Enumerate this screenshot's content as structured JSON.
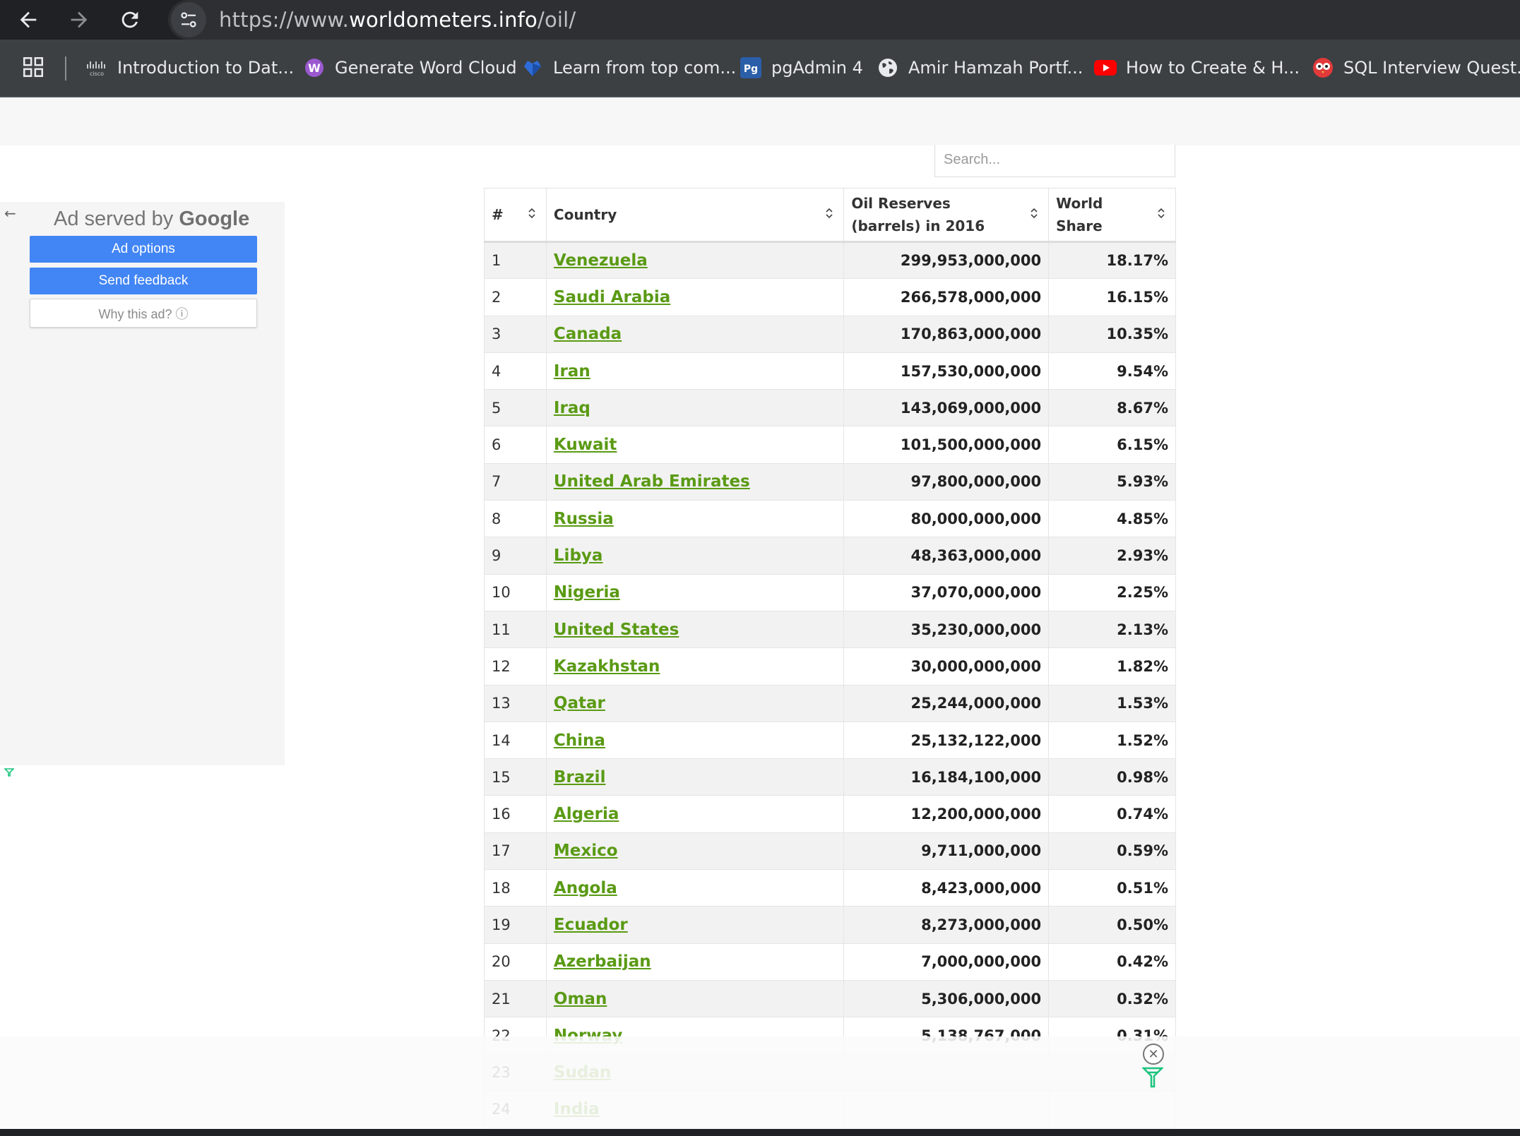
{
  "browser": {
    "url_prefix": "https://www.",
    "url_host": "worldometers.info",
    "url_path": "/oil/",
    "bookmarks": [
      {
        "label": "Introduction to Dat...",
        "icon": "cisco-icon"
      },
      {
        "label": "Generate Word Cloud",
        "icon": "wordcloud-icon"
      },
      {
        "label": "Learn from top com...",
        "icon": "heart-gem-icon"
      },
      {
        "label": "pgAdmin 4",
        "icon": "pgadmin-icon"
      },
      {
        "label": "Amir Hamzah Portf...",
        "icon": "globe-icon"
      },
      {
        "label": "How to Create & H...",
        "icon": "youtube-icon"
      },
      {
        "label": "SQL Interview Quest...",
        "icon": "owl-icon"
      }
    ]
  },
  "search": {
    "placeholder": "Search..."
  },
  "ad": {
    "title_prefix": "Ad served by ",
    "title_brand": "Google",
    "options_label": "Ad options",
    "feedback_label": "Send feedback",
    "why_label": "Why this ad? ⓘ"
  },
  "table": {
    "headers": {
      "index": "#",
      "country": "Country",
      "reserves_line1": "Oil Reserves",
      "reserves_line2": "(barrels) in 2016",
      "share_line1": "World",
      "share_line2": "Share"
    },
    "rows": [
      {
        "rank": "1",
        "country": "Venezuela",
        "reserves": "299,953,000,000",
        "share": "18.17%"
      },
      {
        "rank": "2",
        "country": "Saudi Arabia",
        "reserves": "266,578,000,000",
        "share": "16.15%"
      },
      {
        "rank": "3",
        "country": "Canada",
        "reserves": "170,863,000,000",
        "share": "10.35%"
      },
      {
        "rank": "4",
        "country": "Iran",
        "reserves": "157,530,000,000",
        "share": "9.54%"
      },
      {
        "rank": "5",
        "country": "Iraq",
        "reserves": "143,069,000,000",
        "share": "8.67%"
      },
      {
        "rank": "6",
        "country": "Kuwait",
        "reserves": "101,500,000,000",
        "share": "6.15%"
      },
      {
        "rank": "7",
        "country": "United Arab Emirates",
        "reserves": "97,800,000,000",
        "share": "5.93%"
      },
      {
        "rank": "8",
        "country": "Russia",
        "reserves": "80,000,000,000",
        "share": "4.85%"
      },
      {
        "rank": "9",
        "country": "Libya",
        "reserves": "48,363,000,000",
        "share": "2.93%"
      },
      {
        "rank": "10",
        "country": "Nigeria",
        "reserves": "37,070,000,000",
        "share": "2.25%"
      },
      {
        "rank": "11",
        "country": "United States",
        "reserves": "35,230,000,000",
        "share": "2.13%"
      },
      {
        "rank": "12",
        "country": "Kazakhstan",
        "reserves": "30,000,000,000",
        "share": "1.82%"
      },
      {
        "rank": "13",
        "country": "Qatar",
        "reserves": "25,244,000,000",
        "share": "1.53%"
      },
      {
        "rank": "14",
        "country": "China",
        "reserves": "25,132,122,000",
        "share": "1.52%"
      },
      {
        "rank": "15",
        "country": "Brazil",
        "reserves": "16,184,100,000",
        "share": "0.98%"
      },
      {
        "rank": "16",
        "country": "Algeria",
        "reserves": "12,200,000,000",
        "share": "0.74%"
      },
      {
        "rank": "17",
        "country": "Mexico",
        "reserves": "9,711,000,000",
        "share": "0.59%"
      },
      {
        "rank": "18",
        "country": "Angola",
        "reserves": "8,423,000,000",
        "share": "0.51%"
      },
      {
        "rank": "19",
        "country": "Ecuador",
        "reserves": "8,273,000,000",
        "share": "0.50%"
      },
      {
        "rank": "20",
        "country": "Azerbaijan",
        "reserves": "7,000,000,000",
        "share": "0.42%"
      },
      {
        "rank": "21",
        "country": "Oman",
        "reserves": "5,306,000,000",
        "share": "0.32%"
      },
      {
        "rank": "22",
        "country": "Norway",
        "reserves": "5,138,767,000",
        "share": "0.31%"
      },
      {
        "rank": "23",
        "country": "Sudan",
        "reserves": "",
        "share": ""
      },
      {
        "rank": "24",
        "country": "India",
        "reserves": "",
        "share": ""
      }
    ]
  },
  "colors": {
    "link_green": "#5a9a14",
    "ad_blue": "#4285f4",
    "chrome_dark": "#202124"
  }
}
